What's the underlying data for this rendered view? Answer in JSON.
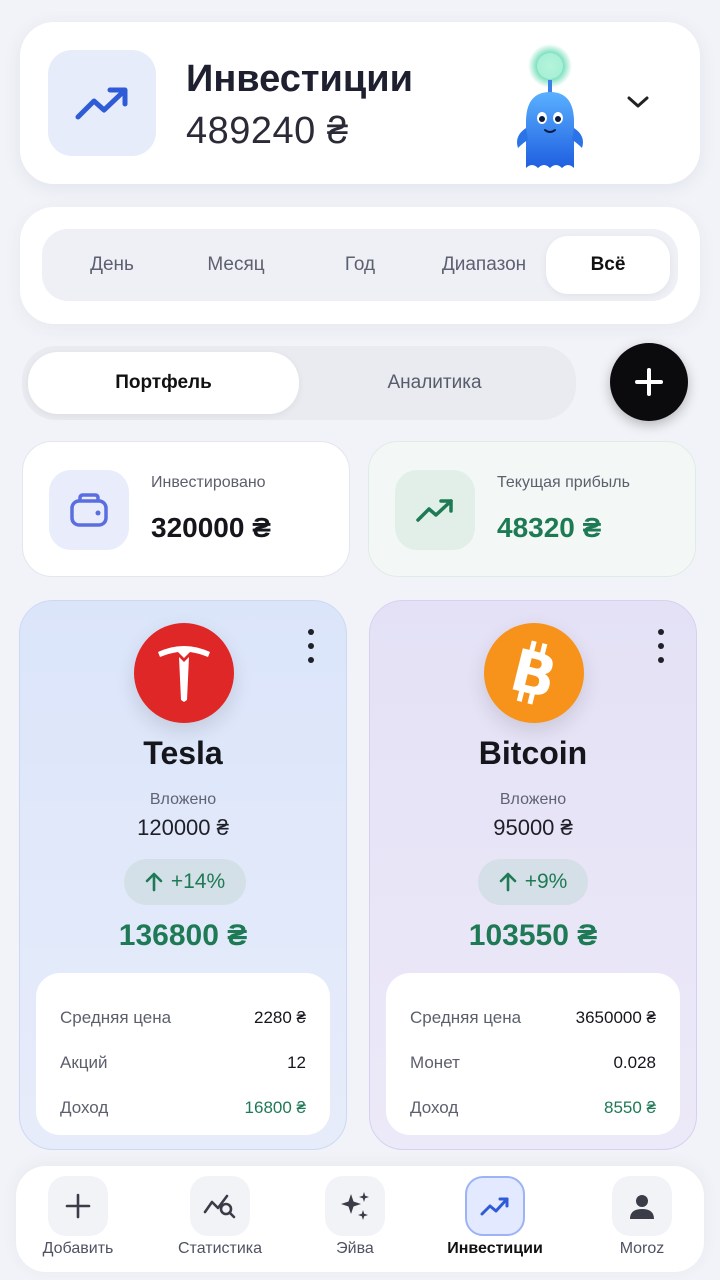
{
  "header": {
    "title": "Инвестиции",
    "amount": "489240 ₴",
    "icon": "trending-up-icon",
    "accent": "#2f5bd6"
  },
  "periods": {
    "items": [
      "День",
      "Месяц",
      "Год",
      "Диапазон",
      "Всё"
    ],
    "selected": "Всё"
  },
  "tabs": {
    "items": [
      "Портфель",
      "Аналитика"
    ],
    "selected": "Портфель"
  },
  "stats": {
    "invested": {
      "label": "Инвестировано",
      "value": "320000 ₴",
      "icon": "wallet-icon"
    },
    "profit": {
      "label": "Текущая прибыль",
      "value": "48320 ₴",
      "icon": "trending-up-icon",
      "color": "#1e7a55"
    }
  },
  "assets": [
    {
      "name": "Tesla",
      "invested_label": "Вложено",
      "invested": "120000 ₴",
      "change": "+14%",
      "total": "136800 ₴",
      "brand_color": "#e02727",
      "details": [
        {
          "label": "Средняя цена",
          "value": "2280 ₴"
        },
        {
          "label": "Акций",
          "value": "12"
        },
        {
          "label": "Доход",
          "value": "16800 ₴"
        }
      ]
    },
    {
      "name": "Bitcoin",
      "invested_label": "Вложено",
      "invested": "95000 ₴",
      "change": "+9%",
      "total": "103550 ₴",
      "brand_color": "#f7931a",
      "details": [
        {
          "label": "Средняя цена",
          "value": "3650000 ₴"
        },
        {
          "label": "Монет",
          "value": "0.028"
        },
        {
          "label": "Доход",
          "value": "8550 ₴"
        }
      ]
    }
  ],
  "nav": {
    "items": [
      {
        "label": "Добавить",
        "icon": "plus-icon"
      },
      {
        "label": "Статистика",
        "icon": "chart-search-icon"
      },
      {
        "label": "Эйва",
        "icon": "sparkles-icon"
      },
      {
        "label": "Инвестиции",
        "icon": "trending-up-icon"
      },
      {
        "label": "Moroz",
        "icon": "user-icon"
      }
    ],
    "selected": "Инвестиции"
  }
}
